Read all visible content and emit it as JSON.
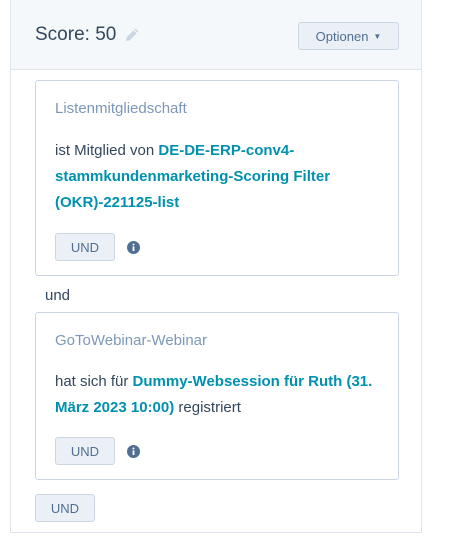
{
  "header": {
    "score_label": "Score: 50",
    "options_label": "Optionen"
  },
  "filters": [
    {
      "title": "Listenmitgliedschaft",
      "prefix": "ist Mitglied von ",
      "link": "DE-DE-ERP-conv4-stammkundenmarketing-Scoring Filter (OKR)-221125-list",
      "suffix": "",
      "and_label": "UND"
    },
    {
      "title": "GoToWebinar-Webinar",
      "prefix": "hat sich für ",
      "link": "Dummy-Websession für Ruth (31. März 2023 10:00)",
      "suffix": " registriert",
      "and_label": "UND"
    }
  ],
  "connector_label": "und",
  "bottom_and_label": "UND",
  "colors": {
    "link": "#0091ae",
    "header_bg": "#f5f8fa",
    "button_bg": "#eaf0f6",
    "muted_text": "#7c98b6"
  },
  "icons": {
    "edit": "pencil-icon",
    "dropdown": "caret-down-icon",
    "info": "info-icon"
  }
}
